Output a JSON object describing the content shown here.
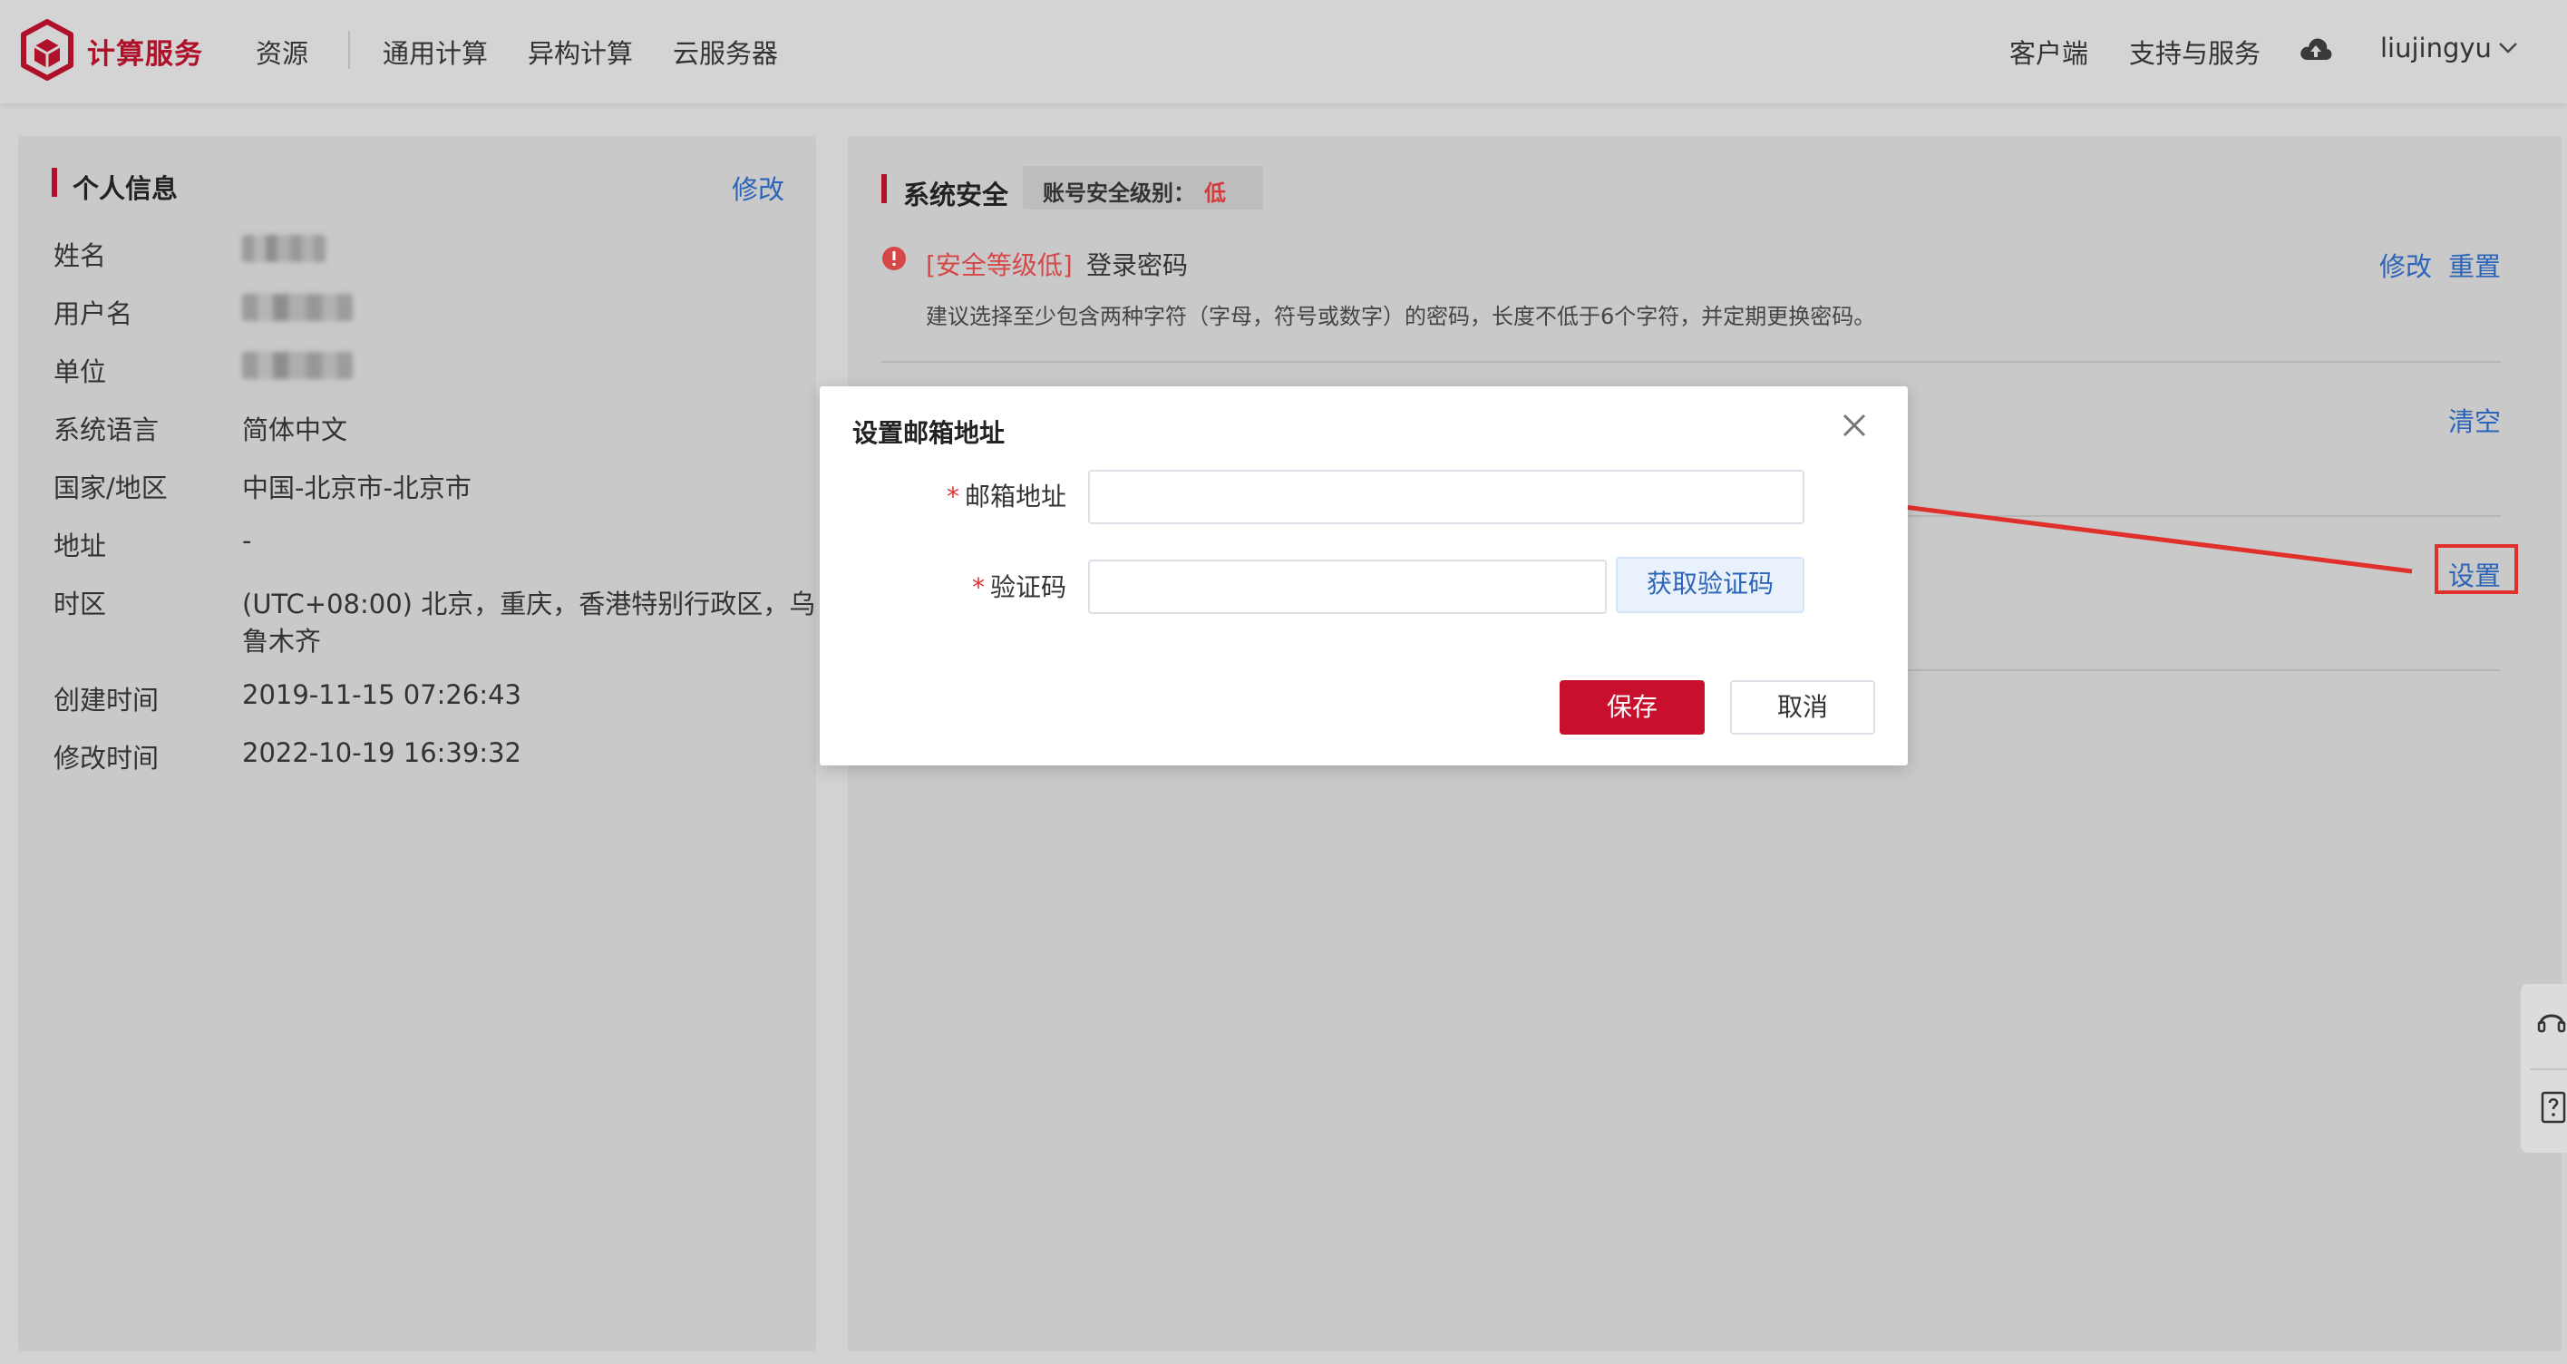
{
  "header": {
    "brand": "计算服务",
    "nav": [
      "资源",
      "通用计算",
      "异构计算",
      "云服务器"
    ],
    "right": {
      "client": "客户端",
      "support": "支持与服务",
      "username": "liujingyu"
    },
    "icons": [
      "cube-logo-icon",
      "cloud-icon",
      "chevron-down-icon"
    ]
  },
  "personal_info": {
    "title": "个人信息",
    "edit_link": "修改",
    "fields": [
      {
        "label": "姓名",
        "value": ""
      },
      {
        "label": "用户名",
        "value": ""
      },
      {
        "label": "单位",
        "value": ""
      },
      {
        "label": "系统语言",
        "value": "简体中文"
      },
      {
        "label": "国家/地区",
        "value": "中国-北京市-北京市"
      },
      {
        "label": "地址",
        "value": "-"
      },
      {
        "label": "时区",
        "value_line1": "(UTC+08:00) 北京，重庆，香港特别行政区，乌",
        "value_line2": "鲁木齐"
      },
      {
        "label": "创建时间",
        "value": "2019-11-15 07:26:43"
      },
      {
        "label": "修改时间",
        "value": "2022-10-19 16:39:32"
      }
    ]
  },
  "security": {
    "title": "系统安全",
    "level_label": "账号安全级别：",
    "level_value": "低",
    "password_item": {
      "tag": "[安全等级低]",
      "title": "登录密码",
      "desc": "建议选择至少包含两种字符（字母，符号或数字）的密码，长度不低于6个字符，并定期更换密码。",
      "edit": "修改",
      "reset": "重置"
    },
    "clear_link": "清空",
    "set_link": "设置"
  },
  "modal": {
    "title": "设置邮箱地址",
    "email_label": "邮箱地址",
    "email_value": "",
    "code_label": "验证码",
    "code_value": "",
    "get_code_button": "获取验证码",
    "save_button": "保存",
    "cancel_button": "取消"
  },
  "colors": {
    "brand": "#b0112a",
    "link": "#2b64b8",
    "warning": "#d64848",
    "save_button": "#c8102e",
    "annotation": "#e0302c"
  }
}
